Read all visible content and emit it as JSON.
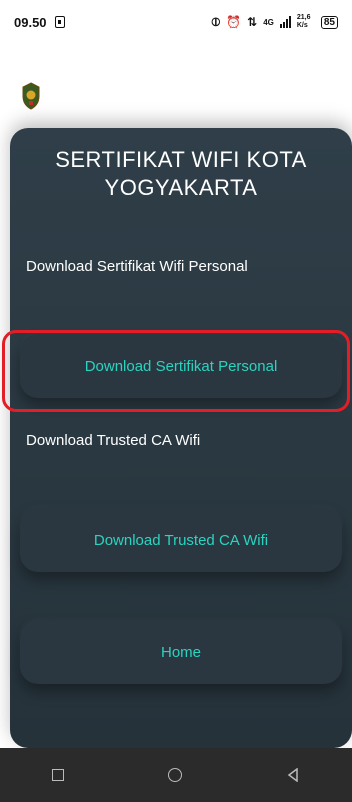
{
  "status_bar": {
    "time": "09.50",
    "network": "4G",
    "speed": "21,6 K/s",
    "battery": "85"
  },
  "card": {
    "title": "SERTIFIKAT WIFI KOTA YOGYAKARTA",
    "section1_label": "Download Sertifikat Wifi Personal",
    "button1": "Download Sertifikat Personal",
    "section2_label": "Download Trusted CA Wifi",
    "button2": "Download Trusted CA Wifi",
    "button3": "Home"
  },
  "colors": {
    "card_bg": "#2f3e48",
    "button_text": "#2ad4c0",
    "highlight": "#e41e26"
  }
}
